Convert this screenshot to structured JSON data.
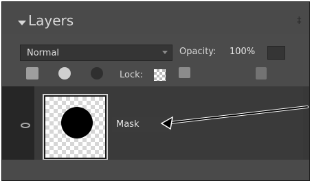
{
  "panel": {
    "title": "Layers"
  },
  "blend_mode": {
    "label": "Normal"
  },
  "opacity": {
    "label": "Opacity:",
    "value": "100%"
  },
  "lock": {
    "label": "Lock:"
  },
  "layers": [
    {
      "name": "Mask"
    }
  ],
  "colors": {
    "panel_bg": "#4b4b4b",
    "header_bg": "#4a4a4a",
    "dark_bg": "#2a2a2a",
    "row_bg": "#3a3a3a",
    "text": "#d8d8d8"
  },
  "icons": [
    "collapse-triangle-icon",
    "eye-icon",
    "new-layer-icon",
    "adjustment-layer-icon",
    "link-layers-icon",
    "lock-transparency-icon",
    "lock-all-icon",
    "trash-icon"
  ]
}
